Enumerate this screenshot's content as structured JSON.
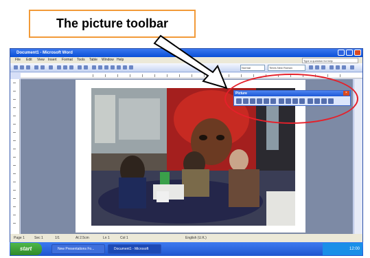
{
  "callout": {
    "label": "The picture toolbar"
  },
  "window": {
    "title": "Document1 - Microsoft Word",
    "menu": [
      "File",
      "Edit",
      "View",
      "Insert",
      "Format",
      "Tools",
      "Table",
      "Window",
      "Help"
    ],
    "style_combo": "Normal",
    "font_combo": "Times New Roman",
    "help_box": "Type a question for help"
  },
  "picture_toolbar": {
    "title": "Picture",
    "close": "×"
  },
  "status": {
    "page": "Page 1",
    "sec": "Sec 1",
    "pos": "1/1",
    "at": "At 2.5cm",
    "ln": "Ln 1",
    "col": "Col 1",
    "lang": "English (U.K.)"
  },
  "taskbar": {
    "start": "start",
    "items": [
      "New Presentations Fo...",
      "Document1 - Microsoft"
    ],
    "clock": "12:00"
  },
  "colors": {
    "callout_border": "#f29a38",
    "highlight": "#e5202a",
    "xp_blue": "#0a4fd6"
  }
}
